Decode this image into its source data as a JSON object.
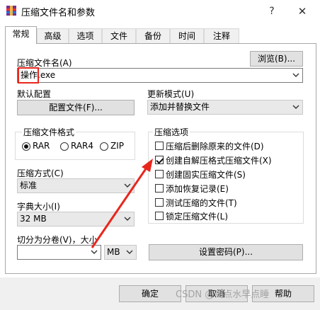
{
  "window": {
    "title": "压缩文件名和参数",
    "help": "?",
    "close": "✕"
  },
  "tabs": [
    "常规",
    "高级",
    "选项",
    "文件",
    "备份",
    "时间",
    "注释"
  ],
  "archive_name": {
    "label": "压缩文件名(A)",
    "browse": "浏览(B)...",
    "value_highlight": "操作",
    "value_rest": ".exe"
  },
  "default_profile": {
    "label": "默认配置",
    "button": "配置文件(F)..."
  },
  "update_mode": {
    "label": "更新模式(U)",
    "value": "添加并替换文件"
  },
  "format": {
    "title": "压缩文件格式",
    "options": [
      "RAR",
      "RAR4",
      "ZIP"
    ],
    "selected": "RAR"
  },
  "method": {
    "label": "压缩方式(C)",
    "value": "标准"
  },
  "dict": {
    "label": "字典大小(I)",
    "value": "32 MB"
  },
  "split": {
    "label": "切分为分卷(V)，大小",
    "value": "",
    "unit": "MB"
  },
  "options": {
    "title": "压缩选项",
    "items": [
      {
        "label": "压缩后删除原来的文件(D)",
        "checked": false
      },
      {
        "label": "创建自解压格式压缩文件(X)",
        "checked": true
      },
      {
        "label": "创建固实压缩文件(S)",
        "checked": false
      },
      {
        "label": "添加恢复记录(E)",
        "checked": false
      },
      {
        "label": "测试压缩的文件(T)",
        "checked": false
      },
      {
        "label": "锁定压缩文件(L)",
        "checked": false
      }
    ]
  },
  "password_button": "设置密码(P)...",
  "buttons": {
    "ok": "确定",
    "cancel": "取消",
    "help": "帮助"
  },
  "watermark": "CSDN @喝点水早点睡",
  "colors": {
    "annotation": "#e8261c",
    "accent": "#0078d7"
  }
}
